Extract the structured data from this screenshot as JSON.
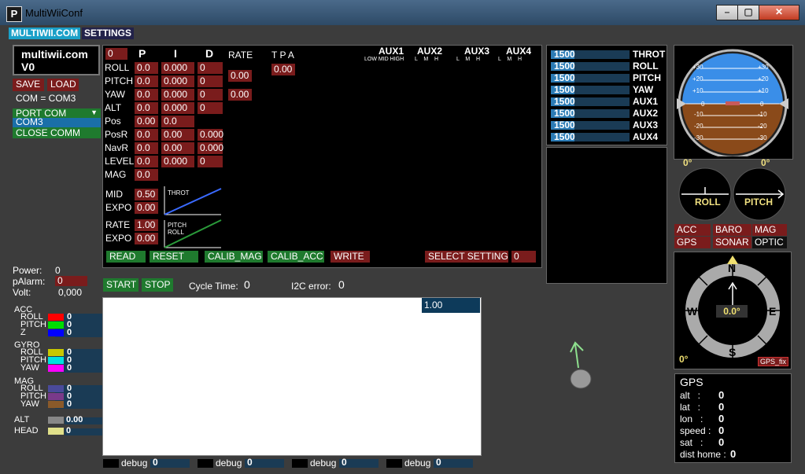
{
  "window": {
    "title": "MultiWiiConf",
    "icon_letter": "P"
  },
  "menu": {
    "tab1": "MULTIWII.COM",
    "tab2": "SETTINGS"
  },
  "brand": {
    "line1": "multiwii.com",
    "line2": "V0"
  },
  "connection": {
    "save": "SAVE",
    "load": "LOAD",
    "com_text": "COM = COM3",
    "port_com": "PORT COM",
    "port_item": "COM3",
    "close_comm": "CLOSE COMM"
  },
  "pid": {
    "first_value": "0",
    "col_p": "P",
    "col_i": "I",
    "col_d": "D",
    "col_rate": "RATE",
    "col_tpa": "T P A",
    "tpa_value": "0.00",
    "rows": [
      {
        "label": "ROLL",
        "p": "0.0",
        "i": "0.000",
        "d": "0"
      },
      {
        "label": "PITCH",
        "p": "0.0",
        "i": "0.000",
        "d": "0"
      },
      {
        "label": "YAW",
        "p": "0.0",
        "i": "0.000",
        "d": "0"
      },
      {
        "label": "ALT",
        "p": "0.0",
        "i": "0.000",
        "d": "0"
      },
      {
        "label": "Pos",
        "p": "0.00",
        "i": "0.0"
      },
      {
        "label": "PosR",
        "p": "0.0",
        "i": "0.00",
        "d": "0.000"
      },
      {
        "label": "NavR",
        "p": "0.0",
        "i": "0.00",
        "d": "0.000"
      },
      {
        "label": "LEVEL",
        "p": "0.0",
        "i": "0.000",
        "d": "0"
      },
      {
        "label": "MAG",
        "p": "0.0"
      }
    ],
    "rate_rollpitch": "0.00",
    "rate_yaw": "0.00",
    "mid_label": "MID",
    "mid_value": "0.50",
    "expo_label": "EXPO",
    "expo_value": "0.00",
    "throt_label": "THROT",
    "rate_label": "RATE",
    "rate_value": "1.00",
    "expo2_label": "EXPO",
    "expo2_value": "0.00",
    "pitch_label": "PITCH",
    "roll_label": "ROLL"
  },
  "aux": {
    "headers": [
      "AUX1",
      "AUX2",
      "AUX3",
      "AUX4"
    ],
    "sub1": "LOW MID HIGH",
    "sub_rest": "L    M    H"
  },
  "actions": {
    "read": "READ",
    "reset": "RESET",
    "calib_mag": "CALIB_MAG",
    "calib_acc": "CALIB_ACC",
    "write": "WRITE",
    "select_setting": "SELECT SETTING",
    "setting_value": "0"
  },
  "rc": [
    {
      "value": "1500",
      "name": "THROT",
      "level": 0.5
    },
    {
      "value": "1500",
      "name": "ROLL",
      "level": 0.5
    },
    {
      "value": "1500",
      "name": "PITCH",
      "level": 0.5
    },
    {
      "value": "1500",
      "name": "YAW",
      "level": 0.5
    },
    {
      "value": "1500",
      "name": "AUX1",
      "level": 0.5
    },
    {
      "value": "1500",
      "name": "AUX2",
      "level": 0.5
    },
    {
      "value": "1500",
      "name": "AUX3",
      "level": 0.5
    },
    {
      "value": "1500",
      "name": "AUX4",
      "level": 0.5
    }
  ],
  "horizon": {
    "ticks_up": [
      "+30",
      "+20",
      "+10"
    ],
    "zero": "0",
    "ticks_down": [
      "-10",
      "-20",
      "-30"
    ],
    "roll_deg": "0°",
    "pitch_deg": "0°",
    "roll_label": "ROLL",
    "pitch_label": "PITCH"
  },
  "sensors": {
    "acc": "ACC",
    "baro": "BARO",
    "mag": "MAG",
    "gps": "GPS",
    "sonar": "SONAR",
    "optic": "OPTIC"
  },
  "compass": {
    "n": "N",
    "e": "E",
    "s": "S",
    "w": "W",
    "heading": "0.0°",
    "corner": "0°",
    "gps_fix": "GPS_fix"
  },
  "gps": {
    "title": "GPS",
    "rows": [
      {
        "label": "alt   :",
        "value": "0"
      },
      {
        "label": "lat   :",
        "value": "0"
      },
      {
        "label": "lon   :",
        "value": "0"
      },
      {
        "label": "speed :",
        "value": "0"
      },
      {
        "label": "sat   :",
        "value": "0"
      },
      {
        "label": "dist home :",
        "value": "0"
      }
    ]
  },
  "power": {
    "power_label": "Power:",
    "power_value": "0",
    "palarm_label": "pAlarm:",
    "palarm_value": "0",
    "volt_label": "Volt:",
    "volt_value": "0,000"
  },
  "sensor_values": {
    "acc": {
      "title": "ACC",
      "rows": [
        {
          "label": "ROLL",
          "value": "0",
          "color": "#ff0000"
        },
        {
          "label": "PITCH",
          "value": "0",
          "color": "#00dd00"
        },
        {
          "label": "Z",
          "value": "0",
          "color": "#0000ff"
        }
      ]
    },
    "gyro": {
      "title": "GYRO",
      "rows": [
        {
          "label": "ROLL",
          "value": "0",
          "color": "#c8c800"
        },
        {
          "label": "PITCH",
          "value": "0",
          "color": "#00e0e0"
        },
        {
          "label": "YAW",
          "value": "0",
          "color": "#ff00ff"
        }
      ]
    },
    "mag": {
      "title": "MAG",
      "rows": [
        {
          "label": "ROLL",
          "value": "0",
          "color": "#4a4a9a"
        },
        {
          "label": "PITCH",
          "value": "0",
          "color": "#7a3a8a"
        },
        {
          "label": "YAW",
          "value": "0",
          "color": "#8a5a2a"
        }
      ]
    },
    "alt": {
      "label": "ALT",
      "value": "0.00",
      "color": "#888888"
    },
    "head": {
      "label": "HEAD",
      "value": "0",
      "color": "#e0e08a"
    }
  },
  "graph": {
    "start": "START",
    "stop": "STOP",
    "cycle_label": "Cycle Time:",
    "cycle_value": "0",
    "i2c_label": "I2C error:",
    "i2c_value": "0",
    "scale": "1.00"
  },
  "debug": [
    {
      "label": "debug",
      "value": "0"
    },
    {
      "label": "debug",
      "value": "0"
    },
    {
      "label": "debug",
      "value": "0"
    },
    {
      "label": "debug",
      "value": "0"
    }
  ]
}
